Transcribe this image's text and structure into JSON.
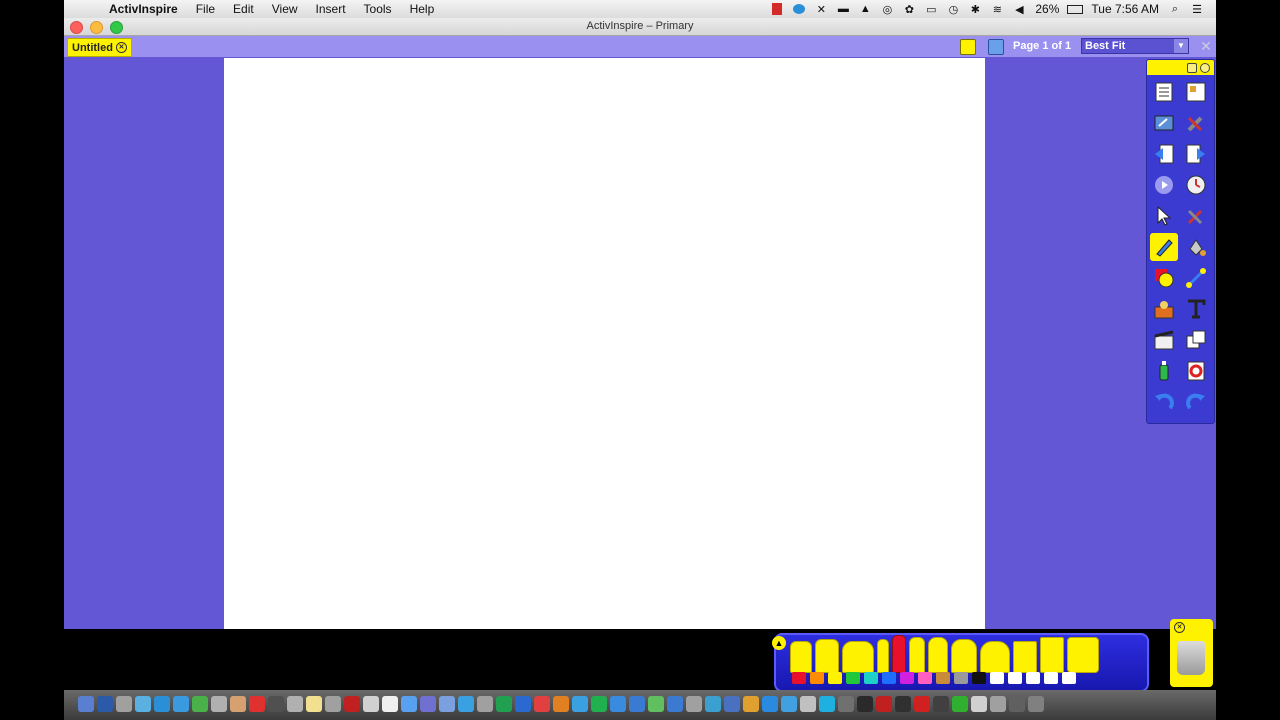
{
  "menubar": {
    "app_name": "ActivInspire",
    "items": [
      "File",
      "Edit",
      "View",
      "Insert",
      "Tools",
      "Help"
    ],
    "battery": "26%",
    "clock": "Tue 7:56 AM"
  },
  "window": {
    "title": "ActivInspire – Primary"
  },
  "tabstrip": {
    "doc_tab": "Untitled",
    "page_info": "Page 1 of 1",
    "zoom": "Best Fit"
  },
  "toolbox": {
    "tools": [
      "flipchart-browser-icon",
      "main-menu-icon",
      "desktop-annotate-icon",
      "edit-profiles-icon",
      "previous-page-icon",
      "next-page-icon",
      "resource-library-icon",
      "clock-icon",
      "select-icon",
      "tools-icon",
      "pen-icon",
      "fill-icon",
      "shape-icon",
      "connector-icon",
      "magic-ink-icon",
      "text-icon",
      "media-icon",
      "duplicate-icon",
      "eraser-icon",
      "reset-page-icon",
      "undo-icon",
      "redo-icon"
    ],
    "selected": "pen-icon"
  },
  "colors": {
    "accent": "#fff200",
    "canvas_bg": "#6457d5",
    "toolbox_bg": "#3b3bd1",
    "swatches": [
      "#e8102a",
      "#ff8c00",
      "#fff200",
      "#21c93a",
      "#1fd0c8",
      "#1e6fff",
      "#d020e0",
      "#ff60c0",
      "#c98a3a",
      "#9a9a9a",
      "#111111",
      "#ffffff",
      "#ffffff",
      "#ffffff",
      "#ffffff",
      "#ffffff"
    ]
  }
}
